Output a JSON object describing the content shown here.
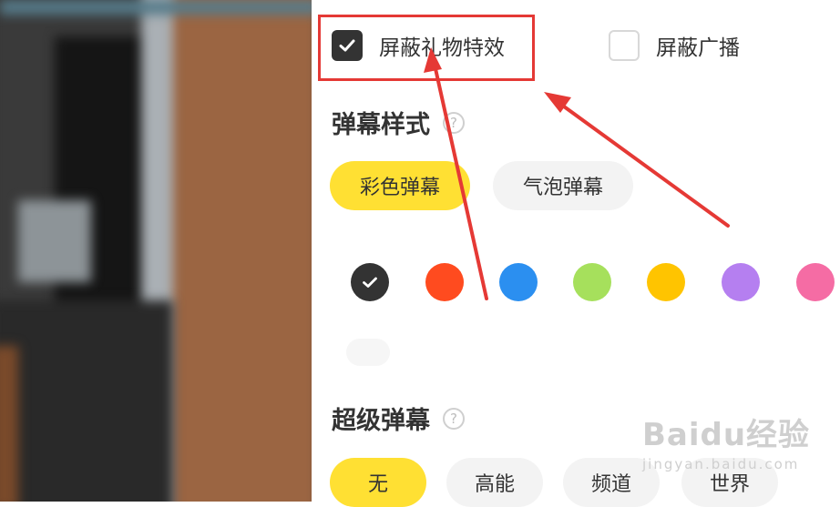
{
  "filters": {
    "block_gift_effects": {
      "label": "屏蔽礼物特效",
      "checked": true
    },
    "block_broadcast": {
      "label": "屏蔽广播",
      "checked": false
    }
  },
  "danmaku_style": {
    "title": "弹幕样式",
    "help": "?",
    "options": [
      "彩色弹幕",
      "气泡弹幕"
    ],
    "selected": "彩色弹幕",
    "colors": [
      "#333333",
      "#ff4b1f",
      "#2b8ff0",
      "#a6e05c",
      "#ffc400",
      "#b57ff0",
      "#f56ca4"
    ],
    "selected_color": "#333333"
  },
  "super_danmaku": {
    "title": "超级弹幕",
    "help": "?",
    "options": [
      "无",
      "高能",
      "频道",
      "世界"
    ],
    "selected": "无"
  },
  "watermark": {
    "logo": "Baidu经验",
    "sub": "jingyan.baidu.com"
  },
  "annotation": {
    "highlight_color": "#e53935"
  }
}
